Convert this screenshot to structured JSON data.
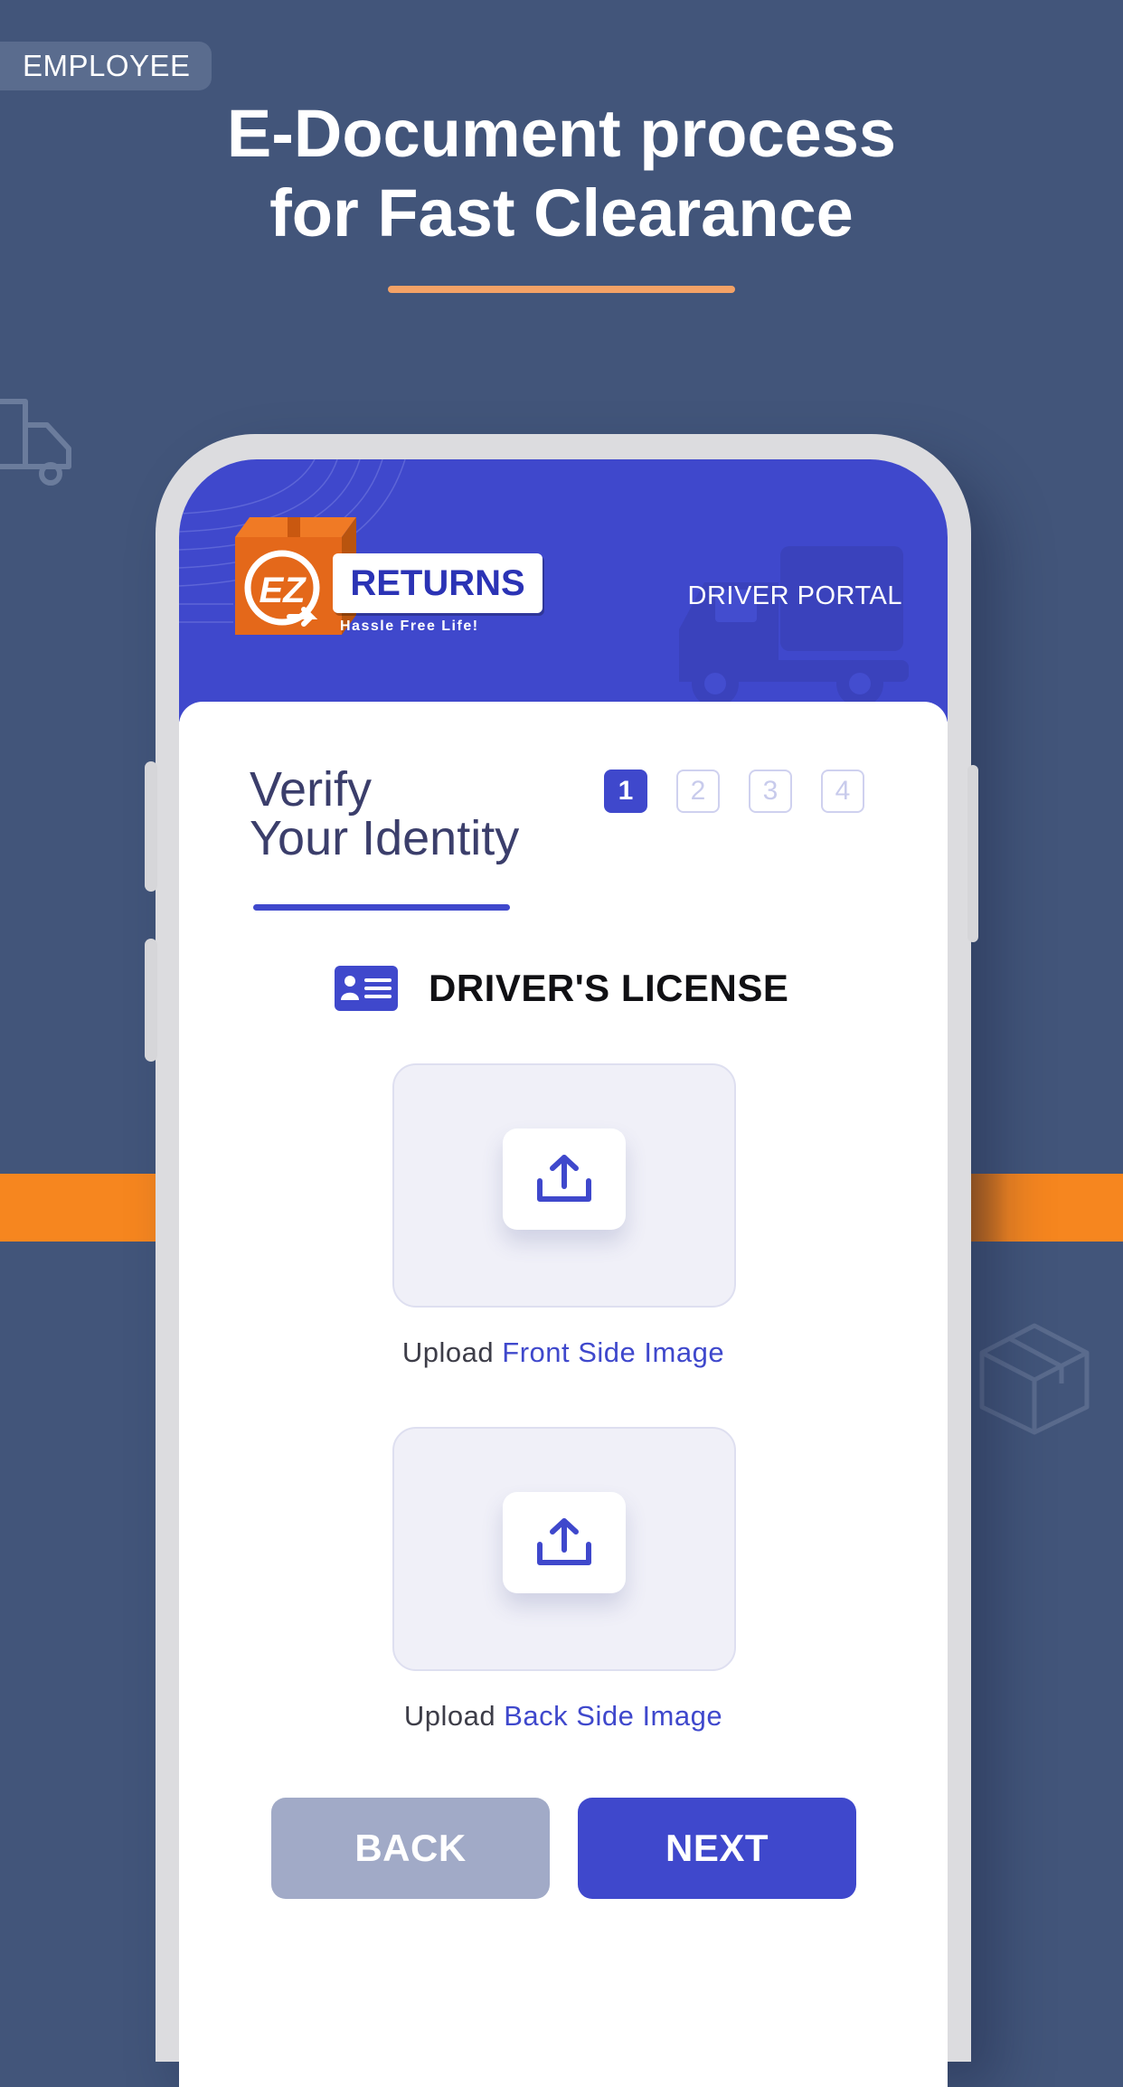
{
  "badge": {
    "label": "EMPLOYEE"
  },
  "headline": {
    "line1": "E-Document process",
    "line2": "for Fast Clearance"
  },
  "app": {
    "logo": {
      "initials": "EZ",
      "name": "RETURNS",
      "tagline": "Hassle Free Life!"
    },
    "portal_label": "DRIVER PORTAL"
  },
  "verify": {
    "title_line1": "Verify",
    "title_line2": "Your Identity",
    "steps": [
      "1",
      "2",
      "3",
      "4"
    ],
    "active_step": 1
  },
  "license": {
    "label": "DRIVER'S LICENSE"
  },
  "uploads": [
    {
      "prefix": "Upload",
      "link": "Front Side Image"
    },
    {
      "prefix": "Upload",
      "link": "Back Side Image"
    }
  ],
  "buttons": {
    "back": "BACK",
    "next": "NEXT"
  },
  "colors": {
    "background": "#42557a",
    "accent": "#3f48cc",
    "orange": "#f6861f",
    "disabled": "#a1aac7"
  },
  "icons": [
    "truck-icon",
    "box-icon",
    "id-card-icon",
    "upload-icon"
  ]
}
